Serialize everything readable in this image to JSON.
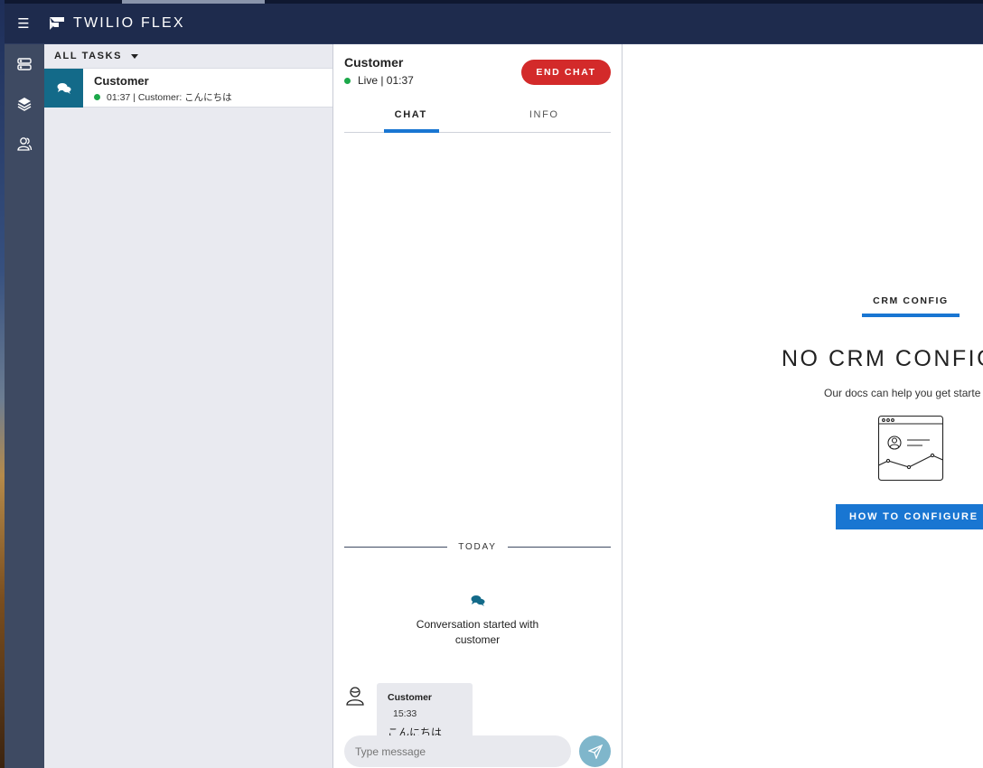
{
  "header": {
    "brand": "TWILIO FLEX",
    "menu_icon": "hamburger-icon",
    "logo_icon": "twilio-flex-logo"
  },
  "sidenav": {
    "items": [
      {
        "name": "agent-desktop",
        "icon": "server-icon"
      },
      {
        "name": "layers",
        "icon": "layers-icon"
      },
      {
        "name": "teams",
        "icon": "user-group-icon"
      }
    ]
  },
  "tasklist": {
    "filter_label": "ALL TASKS",
    "tasks": [
      {
        "name": "Customer",
        "status_time": "01:37 | Customer: こんにちは",
        "channel_icon": "chat-bubbles-icon"
      }
    ]
  },
  "chat": {
    "customer_name": "Customer",
    "status": "Live | 01:37",
    "end_chat_label": "END CHAT",
    "tabs": [
      {
        "label": "CHAT",
        "active": true
      },
      {
        "label": "INFO",
        "active": false
      }
    ],
    "divider_label": "TODAY",
    "started_text": "Conversation started with customer",
    "messages": [
      {
        "author": "Customer",
        "time": "15:33",
        "text": "こんにちは"
      }
    ],
    "input_placeholder": "Type message"
  },
  "crm": {
    "tab_label": "CRM CONFIG",
    "title": "NO CRM CONFIGU",
    "docs_text": "Our docs can help you get starte",
    "button_label": "HOW TO CONFIGURE"
  },
  "colors": {
    "accent": "#1976d2",
    "end_chat": "#d32a2a",
    "header": "#1e2b4d",
    "live_dot": "#1ca84a",
    "channel": "#136a89"
  }
}
